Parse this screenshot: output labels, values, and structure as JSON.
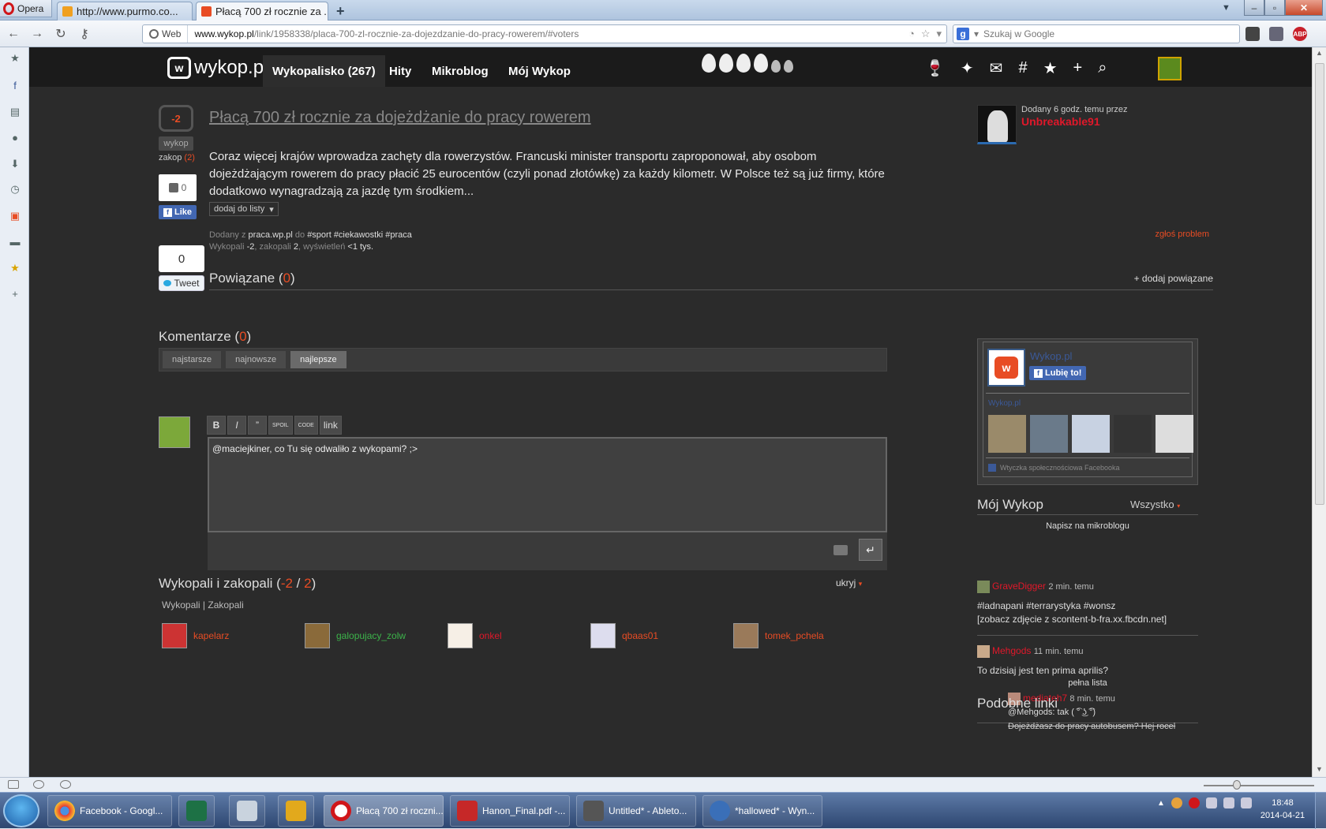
{
  "browser": {
    "menu_label": "Opera",
    "tabs": [
      {
        "title": "http://www.purmo.co..."
      },
      {
        "title": "Płacą 700 zł rocznie za ..."
      }
    ],
    "address_badge": "Web",
    "url_host": "www.wykop.pl",
    "url_path": "/link/1958338/placa-700-zl-rocznie-za-dojezdzanie-do-pracy-rowerem/#voters",
    "search_placeholder": "Szukaj w Google"
  },
  "site": {
    "logo_text": "wykop.pl",
    "nav": [
      {
        "label": "Wykopalisko (267)"
      },
      {
        "label": "Hity"
      },
      {
        "label": "Mikroblog"
      },
      {
        "label": "Mój Wykop"
      }
    ]
  },
  "article": {
    "votes": "-2",
    "wykop_label": "wykop",
    "zakop_label": "zakop",
    "zakop_count": "(2)",
    "fb_like_count": "0",
    "fb_like_label": "Like",
    "tweet_count": "0",
    "tweet_label": "Tweet",
    "title": "Płacą 700 zł rocznie za dojeżdżanie do pracy rowerem",
    "description": "Coraz więcej krajów wprowadza zachęty dla rowerzystów. Francuski minister transportu zaproponował, aby osobom dojeżdżającym rowerem do pracy płacić 25 eurocentów (czyli ponad złotówkę) za każdy kilometr. W Polsce też są już firmy, które dodatkowo wynagradzają za jazdę tym środkiem...",
    "add_to_list": "dodaj do listy",
    "meta_prefix": "Dodany z",
    "meta_source": "praca.wp.pl",
    "meta_to": "do",
    "meta_tags": "#sport #ciekawostki #praca",
    "meta_stats_a": "Wykopali",
    "meta_stats_b": "-2",
    "meta_stats_c": ", zakopali",
    "meta_stats_d": "2",
    "meta_stats_e": ", wyświetleń",
    "meta_stats_f": "<1 tys.",
    "report": "zgłoś problem",
    "author_added": "Dodany 6 godz. temu przez",
    "author_name": "Unbreakable91"
  },
  "related": {
    "title": "Powiązane",
    "count": "0",
    "add": "+ dodaj powiązane"
  },
  "comments": {
    "title": "Komentarze",
    "count": "0",
    "sort": [
      {
        "label": "najstarsze"
      },
      {
        "label": "najnowsze"
      },
      {
        "label": "najlepsze"
      }
    ],
    "tools": [
      {
        "label": "B"
      },
      {
        "label": "I"
      },
      {
        "label": "”"
      },
      {
        "label": "SPOIL"
      },
      {
        "label": "CODE"
      },
      {
        "label": "link"
      }
    ],
    "draft": "@maciejkiner, co Tu się odwaliło z wykopami? ;>",
    "send_icon": "↵"
  },
  "voters": {
    "title": "Wykopali i zakopali",
    "wykopali": "-2",
    "sep": "/",
    "zakopali": "2",
    "hide": "ukryj",
    "tab_wykopali": "Wykopali",
    "tab_zakopali": "Zakopali",
    "list": [
      {
        "name": "kapelarz",
        "color": "#e84c24"
      },
      {
        "name": "galopujacy_zolw",
        "color": "#3cb34a"
      },
      {
        "name": "onkel",
        "color": "#e0182a"
      },
      {
        "name": "qbaas01",
        "color": "#e84c24"
      },
      {
        "name": "tomek_pchela",
        "color": "#e84c24"
      }
    ]
  },
  "fb_plugin": {
    "page_name": "Wykop.pl",
    "like_label": "Lubię to!",
    "count_link": "Wykop.pl",
    "footer": "Wtyczka społecznościowa Facebooka"
  },
  "my_wykop": {
    "title": "Mój Wykop",
    "filter": "Wszystko",
    "write": "Napisz na mikroblogu",
    "entries": [
      {
        "author": "GraveDigger",
        "time": "2 min. temu",
        "body1": "#ladnapani #terrarystyka #wonsz",
        "body2": "[zobacz zdjęcie z scontent-b-fra.xx.fbcdn.net]"
      },
      {
        "author": "Mehgods",
        "time": "11 min. temu",
        "body1": "To dzisiaj jest ten prima aprilis?"
      }
    ],
    "reply": {
      "author": "mediateh7",
      "time": "8 min. temu",
      "body": "@Mehgods: tak ( ͡° ͜ʖ ͡°)"
    },
    "full_list": "pełna lista",
    "similar_title": "Podobne linki",
    "similar_item": "Dojeżdżasz do pracy autobusem? Hej rocel"
  },
  "taskbar": {
    "items": [
      {
        "label": "Facebook - Googl..."
      },
      {
        "label": "Płacą 700 zł roczni..."
      },
      {
        "label": "Hanon_Final.pdf -..."
      },
      {
        "label": "Untitled* - Ableto..."
      },
      {
        "label": "*hallowed* - Wyn..."
      }
    ],
    "time": "18:48",
    "date": "2014-04-21"
  },
  "colors": {
    "accent": "#e84c24",
    "author": "#e0182a",
    "facebook": "#4267b2"
  }
}
